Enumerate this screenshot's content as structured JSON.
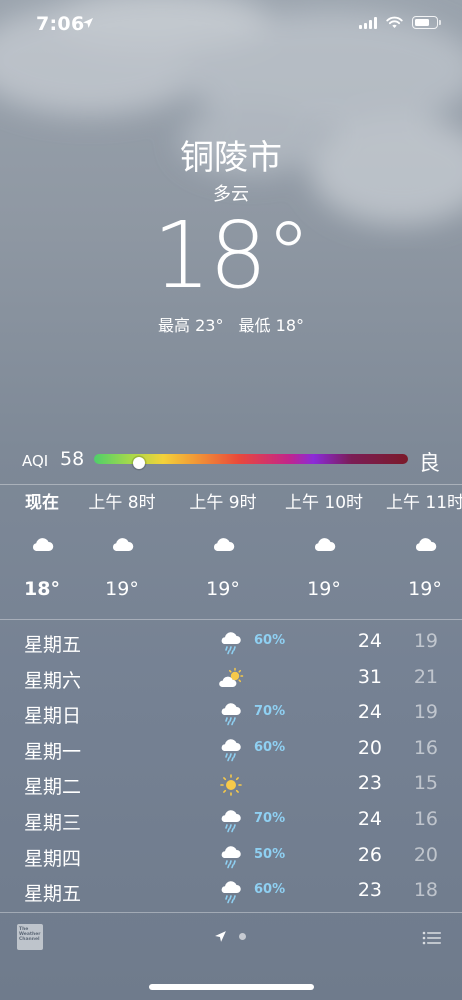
{
  "status_bar": {
    "time": "7:06",
    "location_icon": "location-arrow-icon",
    "signal_icon": "cellular-signal-icon",
    "wifi_icon": "wifi-icon",
    "battery_icon": "battery-icon"
  },
  "current": {
    "city": "铜陵市",
    "condition": "多云",
    "temperature": "18°",
    "high": "最高 23°",
    "low": "最低 18°"
  },
  "aqi": {
    "label": "AQI",
    "value": "58",
    "level": "良",
    "indicator_fraction": 0.142
  },
  "hourly": [
    {
      "label": "现在",
      "icon": "cloud-icon",
      "temp": "18°",
      "now": true
    },
    {
      "label": "上午 8时",
      "icon": "cloud-icon",
      "temp": "19°"
    },
    {
      "label": "上午 9时",
      "icon": "cloud-icon",
      "temp": "19°"
    },
    {
      "label": "上午 10时",
      "icon": "cloud-icon",
      "temp": "19°"
    },
    {
      "label": "上午 11时",
      "icon": "cloud-icon",
      "temp": "19°"
    }
  ],
  "daily": [
    {
      "day": "星期五",
      "icon": "cloud-rain-icon",
      "pop": "60%",
      "high": "24",
      "low": "19"
    },
    {
      "day": "星期六",
      "icon": "partly-sunny-icon",
      "pop": "",
      "high": "31",
      "low": "21"
    },
    {
      "day": "星期日",
      "icon": "cloud-rain-icon",
      "pop": "70%",
      "high": "24",
      "low": "19"
    },
    {
      "day": "星期一",
      "icon": "cloud-rain-icon",
      "pop": "60%",
      "high": "20",
      "low": "16"
    },
    {
      "day": "星期二",
      "icon": "sun-icon",
      "pop": "",
      "high": "23",
      "low": "15"
    },
    {
      "day": "星期三",
      "icon": "cloud-rain-icon",
      "pop": "70%",
      "high": "24",
      "low": "16"
    },
    {
      "day": "星期四",
      "icon": "cloud-rain-icon",
      "pop": "50%",
      "high": "26",
      "low": "20"
    },
    {
      "day": "星期五",
      "icon": "cloud-rain-icon",
      "pop": "60%",
      "high": "23",
      "low": "18"
    }
  ],
  "footer": {
    "logo_text": "The Weather Channel",
    "location_icon": "location-arrow-icon",
    "page_dot_icon": "page-dot-icon",
    "list_icon": "list-icon"
  },
  "colors": {
    "precip_text": "#8fd0f2",
    "sun": "#f6c94a",
    "low_temp_text": "rgba(255,255,255,0.55)"
  }
}
